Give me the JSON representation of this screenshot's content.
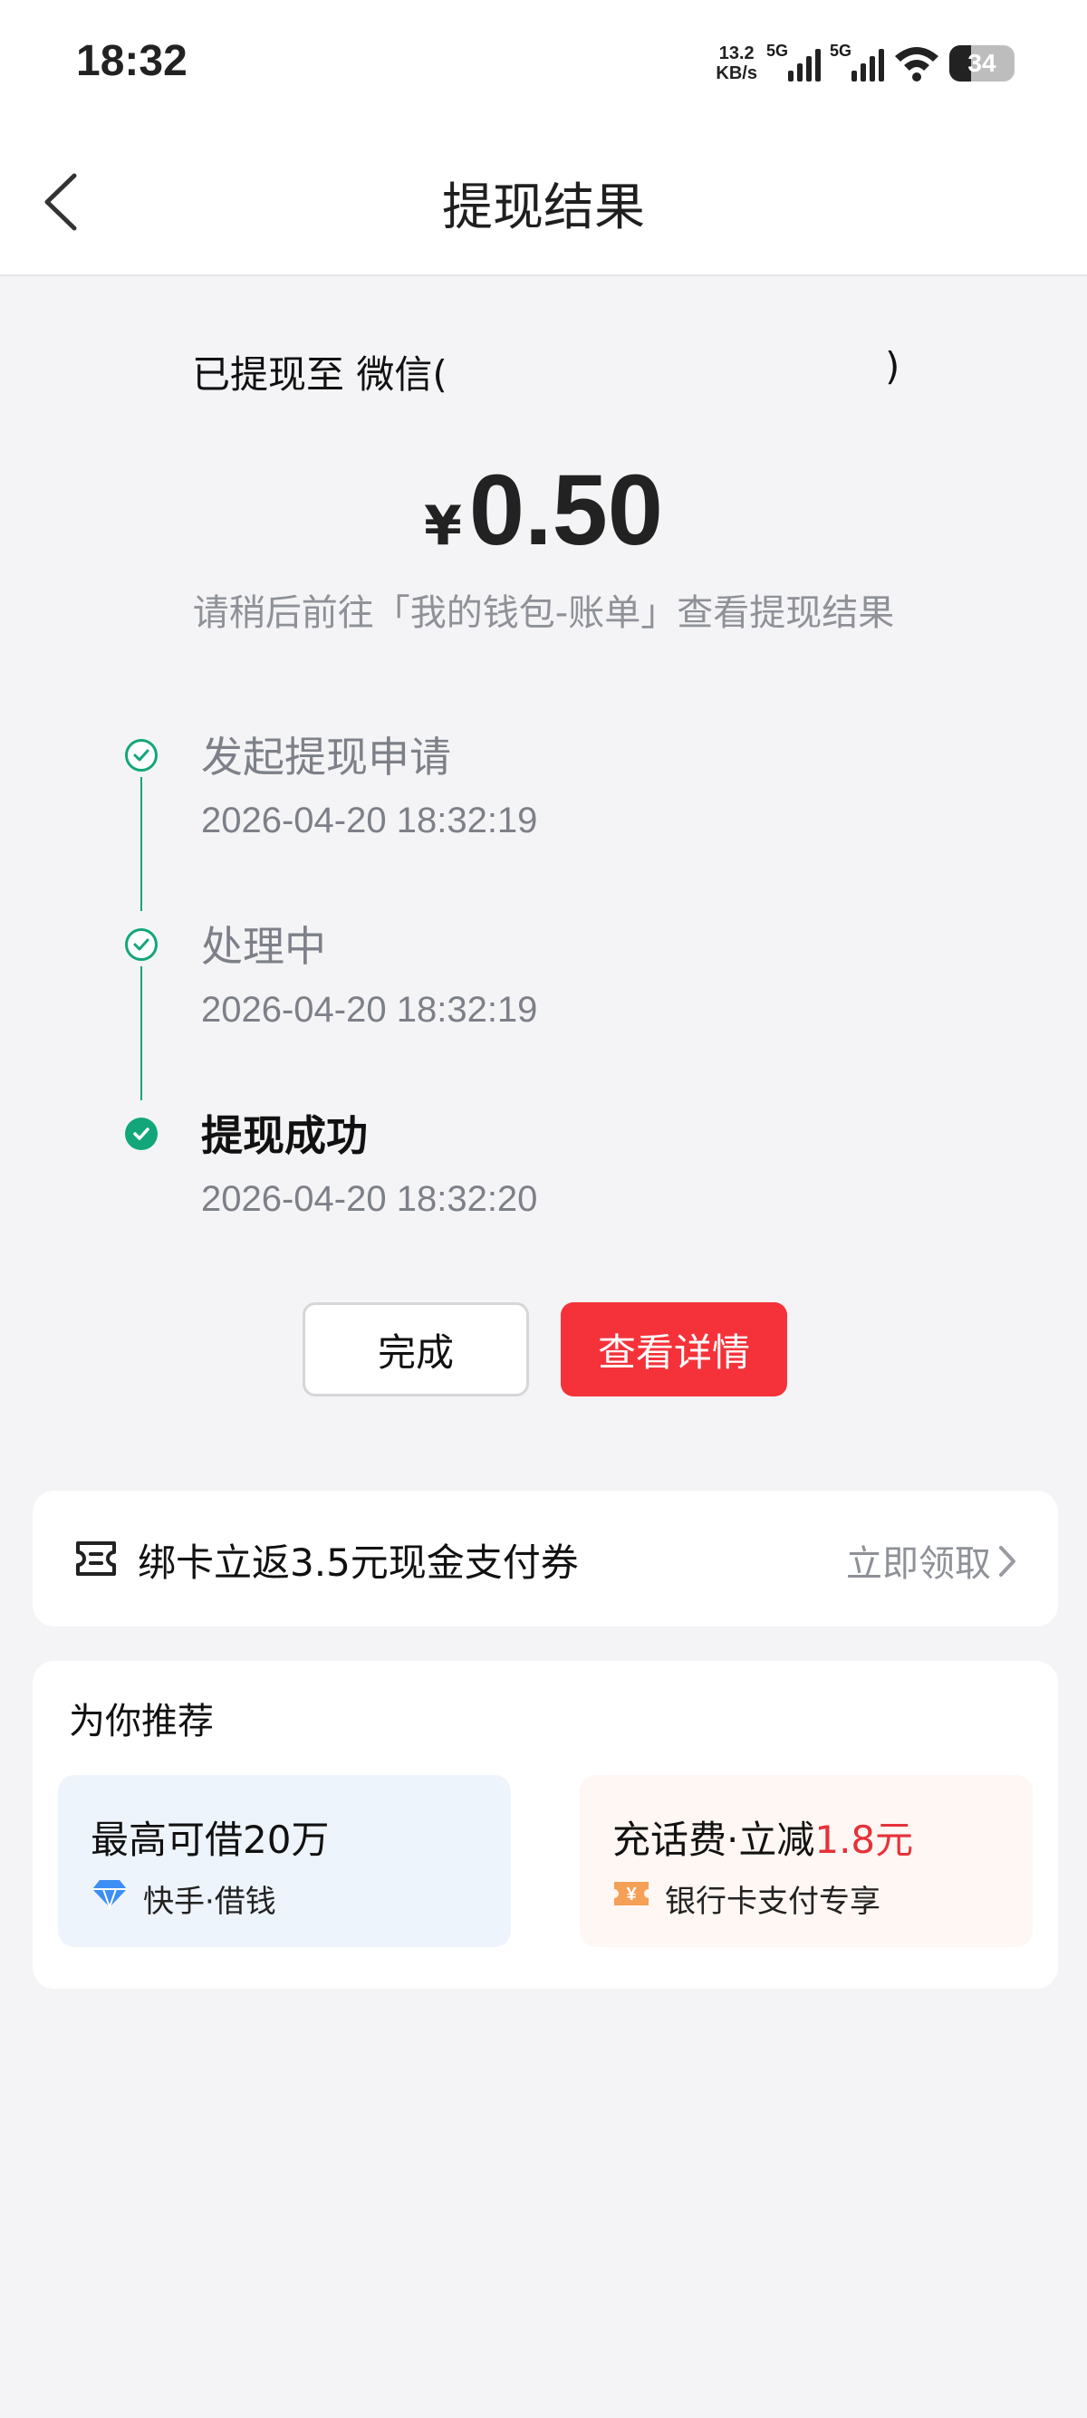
{
  "status_bar": {
    "time": "18:32",
    "net_speed_value": "13.2",
    "net_speed_unit": "KB/s",
    "sim1_tag": "5G",
    "sim2_tag": "5G",
    "battery": "34"
  },
  "nav": {
    "title": "提现结果",
    "back_icon": "chevron-left-icon"
  },
  "result": {
    "target_prefix": "已提现至 微信(",
    "target_suffix": ")",
    "currency": "¥",
    "amount": "0.50",
    "hint": "请稍后前往「我的钱包-账单」查看提现结果"
  },
  "timeline": {
    "accent_color": "#12a67a",
    "steps": [
      {
        "title": "发起提现申请",
        "time": "2026-04-20 18:32:19",
        "state": "done"
      },
      {
        "title": "处理中",
        "time": "2026-04-20 18:32:19",
        "state": "done"
      },
      {
        "title": "提现成功",
        "time": "2026-04-20 18:32:20",
        "state": "current"
      }
    ]
  },
  "actions": {
    "done_label": "完成",
    "detail_label": "查看详情",
    "detail_color": "#f5323a"
  },
  "promo": {
    "icon": "ticket-icon",
    "label": "绑卡立返3.5元现金支付券",
    "link_label": "立即领取"
  },
  "recommend": {
    "title": "为你推荐",
    "items": [
      {
        "main": "最高可借20万",
        "sub": "快手·借钱",
        "icon": "diamond-icon"
      },
      {
        "main_prefix": "充话费·立减",
        "main_highlight": "1.8元",
        "sub": "银行卡支付专享",
        "icon": "yuan-coupon-icon"
      }
    ]
  }
}
